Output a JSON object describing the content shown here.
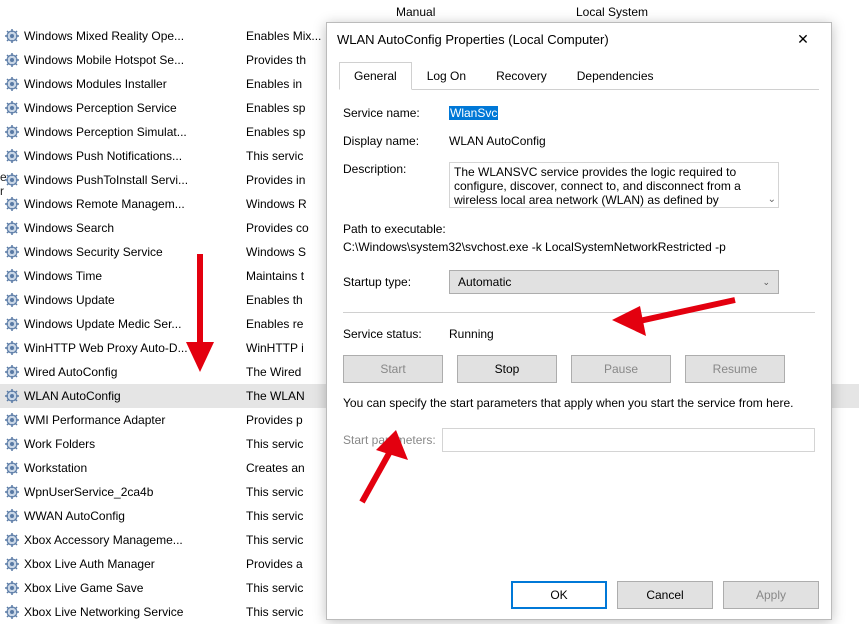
{
  "header": {
    "col_startup": "Manual",
    "col_logon": "Local System"
  },
  "services": [
    {
      "name": "Windows Mixed Reality Ope...",
      "desc": "Enables Mix..."
    },
    {
      "name": "Windows Mobile Hotspot Se...",
      "desc": "Provides th"
    },
    {
      "name": "Windows Modules Installer",
      "desc": "Enables in"
    },
    {
      "name": "Windows Perception Service",
      "desc": "Enables sp"
    },
    {
      "name": "Windows Perception Simulat...",
      "desc": "Enables sp"
    },
    {
      "name": "Windows Push Notifications...",
      "desc": "This servic"
    },
    {
      "name": "Windows PushToInstall Servi...",
      "desc": "Provides in"
    },
    {
      "name": "Windows Remote Managem...",
      "desc": "Windows R"
    },
    {
      "name": "Windows Search",
      "desc": "Provides co"
    },
    {
      "name": "Windows Security Service",
      "desc": "Windows S"
    },
    {
      "name": "Windows Time",
      "desc": "Maintains t"
    },
    {
      "name": "Windows Update",
      "desc": "Enables th"
    },
    {
      "name": "Windows Update Medic Ser...",
      "desc": "Enables re"
    },
    {
      "name": "WinHTTP Web Proxy Auto-D...",
      "desc": "WinHTTP i"
    },
    {
      "name": "Wired AutoConfig",
      "desc": "The Wired"
    },
    {
      "name": "WLAN AutoConfig",
      "desc": "The WLAN",
      "selected": true
    },
    {
      "name": "WMI Performance Adapter",
      "desc": "Provides p"
    },
    {
      "name": "Work Folders",
      "desc": "This servic"
    },
    {
      "name": "Workstation",
      "desc": "Creates an"
    },
    {
      "name": "WpnUserService_2ca4b",
      "desc": "This servic"
    },
    {
      "name": "WWAN AutoConfig",
      "desc": "This servic"
    },
    {
      "name": "Xbox Accessory Manageme...",
      "desc": "This servic"
    },
    {
      "name": "Xbox Live Auth Manager",
      "desc": "Provides a"
    },
    {
      "name": "Xbox Live Game Save",
      "desc": "This servic"
    },
    {
      "name": "Xbox Live Networking Service",
      "desc": "This servic"
    }
  ],
  "dialog": {
    "title": "WLAN AutoConfig Properties (Local Computer)",
    "tabs": {
      "general": "General",
      "logon": "Log On",
      "recovery": "Recovery",
      "deps": "Dependencies"
    },
    "labels": {
      "service_name": "Service name:",
      "display_name": "Display name:",
      "description": "Description:",
      "path": "Path to executable:",
      "startup": "Startup type:",
      "status": "Service status:",
      "hint": "You can specify the start parameters that apply when you start the service from here.",
      "params": "Start parameters:"
    },
    "values": {
      "service_name": "WlanSvc",
      "display_name": "WLAN AutoConfig",
      "description": "The WLANSVC service provides the logic required to configure, discover, connect to, and disconnect from a wireless local area network (WLAN) as defined by",
      "path": "C:\\Windows\\system32\\svchost.exe -k LocalSystemNetworkRestricted -p",
      "startup": "Automatic",
      "status": "Running",
      "params": ""
    },
    "buttons": {
      "start": "Start",
      "stop": "Stop",
      "pause": "Pause",
      "resume": "Resume",
      "ok": "OK",
      "cancel": "Cancel",
      "apply": "Apply"
    }
  },
  "left_edge": {
    "l1": "e",
    "l2": "r"
  }
}
